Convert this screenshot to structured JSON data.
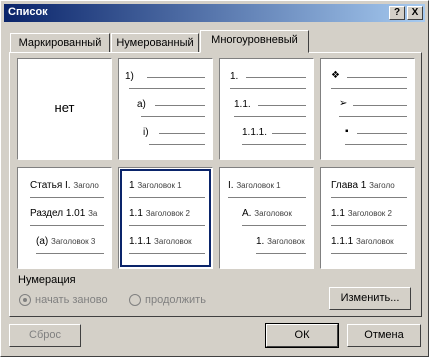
{
  "window": {
    "title": "Список",
    "help_label": "?",
    "close_label": "X"
  },
  "tabs": [
    {
      "label": "Маркированный",
      "active": false
    },
    {
      "label": "Нумерованный",
      "active": false
    },
    {
      "label": "Многоуровневый",
      "active": true
    }
  ],
  "styles": {
    "none_label": "нет",
    "cell1": {
      "r1": "1)",
      "r2": "a)",
      "r3": "i)"
    },
    "cell2": {
      "r1": "1.",
      "r2": "1.1.",
      "r3": "1.1.1."
    },
    "cell3": {
      "r1": "❖",
      "r2": "➢",
      "r3": "▪"
    },
    "cell4": {
      "r1a": "Статья I.",
      "r1b": "Заголо",
      "r2a": "Раздел 1.01",
      "r2b": "За",
      "r3a": "(a)",
      "r3b": "Заголовок 3"
    },
    "cell5": {
      "r1a": "1",
      "r1b": "Заголовок 1",
      "r2a": "1.1",
      "r2b": "Заголовок 2",
      "r3a": "1.1.1",
      "r3b": "Заголовок"
    },
    "cell6": {
      "r1a": "I.",
      "r1b": "Заголовок 1",
      "r2a": "A.",
      "r2b": "Заголовок",
      "r3a": "1.",
      "r3b": "Заголовок"
    },
    "cell7": {
      "r1a": "Глава 1",
      "r1b": "Заголо",
      "r2a": "1.1",
      "r2b": "Заголовок 2",
      "r3a": "1.1.1",
      "r3b": "Заголовок"
    }
  },
  "numbering": {
    "label": "Нумерация",
    "restart_label": "начать заново",
    "continue_label": "продолжить"
  },
  "buttons": {
    "change_label": "Изменить...",
    "reset_label": "Сброс",
    "ok_label": "ОК",
    "cancel_label": "Отмена"
  }
}
